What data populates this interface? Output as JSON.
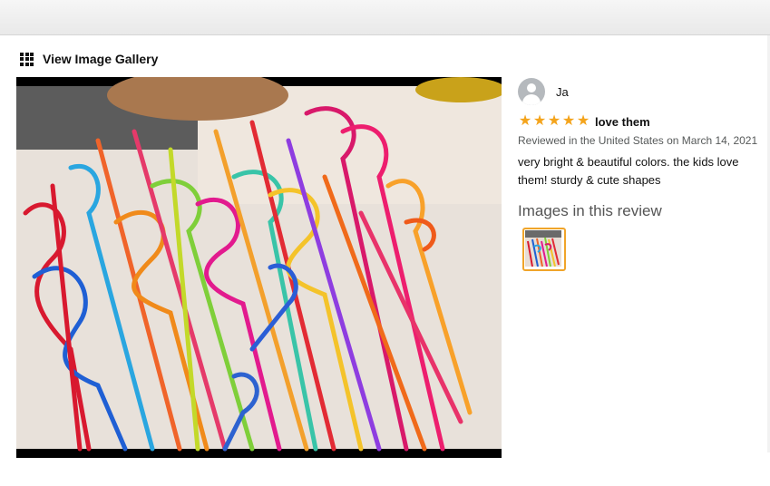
{
  "gallery": {
    "link_label": "View Image Gallery",
    "icon": "grid-icon"
  },
  "photo": {
    "subject": "image"
  },
  "review": {
    "author": "Ja",
    "avatar_icon": "person-icon",
    "rating": 5,
    "rating_max": 5,
    "title": "love them",
    "date_line": "Reviewed in the United States on March 14, 2021",
    "body": "very bright & beautiful colors. the kids love them! sturdy & cute shapes",
    "images_heading": "Images in this review",
    "star_color": "#f4a41c",
    "thumbnail_border_color": "#f0a42a"
  }
}
